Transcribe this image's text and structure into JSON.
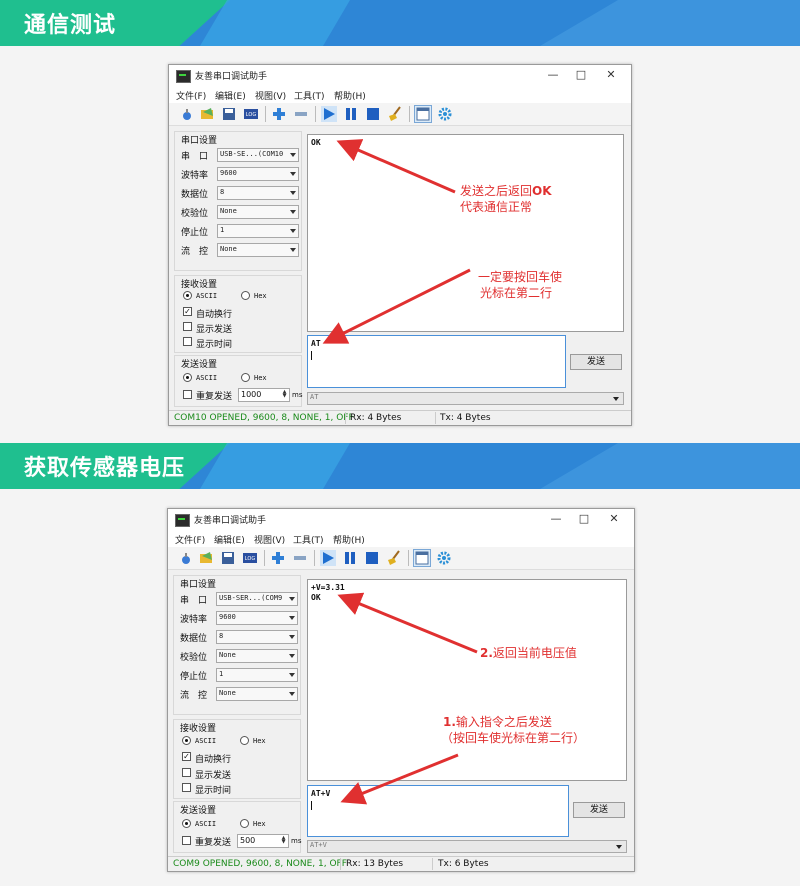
{
  "sections": [
    {
      "banner": "通信测试",
      "window": {
        "title": "友善串口调试助手",
        "menu": [
          "文件(F)",
          "编辑(E)",
          "视图(V)",
          "工具(T)",
          "帮助(H)"
        ],
        "serial": {
          "heading": "串口设置",
          "port_label": "串　口",
          "port": "USB-SE...(COM10",
          "baud_label": "波特率",
          "baud": "9600",
          "data_label": "数据位",
          "data_bits": "8",
          "parity_label": "校验位",
          "parity": "None",
          "stop_label": "停止位",
          "stop_bits": "1",
          "flow_label": "流　控",
          "flow": "None"
        },
        "receive": {
          "heading": "接收设置",
          "ascii": "ASCII",
          "hex": "Hex",
          "auto_newline": "自动换行",
          "show_send": "显示发送",
          "show_time": "显示时间"
        },
        "send": {
          "heading": "发送设置",
          "ascii": "ASCII",
          "hex": "Hex",
          "repeat": "重复发送",
          "interval": "1000",
          "unit": "ms"
        },
        "rx_text": "OK",
        "tx_text": "AT",
        "send_button": "发送",
        "history": "AT",
        "status": {
          "port": "COM10 OPENED, 9600, 8, NONE, 1, OFF",
          "rx": "Rx: 4 Bytes",
          "tx": "Tx: 4 Bytes"
        }
      },
      "annotations": {
        "a1_line1_pre": "发送之后返回",
        "a1_line1_bold": "OK",
        "a1_line2": "代表通信正常",
        "a2_line1": "一定要按回车使",
        "a2_line2": "光标在第二行"
      }
    },
    {
      "banner": "获取传感器电压",
      "window": {
        "title": "友善串口调试助手",
        "menu": [
          "文件(F)",
          "编辑(E)",
          "视图(V)",
          "工具(T)",
          "帮助(H)"
        ],
        "serial": {
          "heading": "串口设置",
          "port_label": "串　口",
          "port": "USB-SER...(COM9",
          "baud_label": "波特率",
          "baud": "9600",
          "data_label": "数据位",
          "data_bits": "8",
          "parity_label": "校验位",
          "parity": "None",
          "stop_label": "停止位",
          "stop_bits": "1",
          "flow_label": "流　控",
          "flow": "None"
        },
        "receive": {
          "heading": "接收设置",
          "ascii": "ASCII",
          "hex": "Hex",
          "auto_newline": "自动换行",
          "show_send": "显示发送",
          "show_time": "显示时间"
        },
        "send": {
          "heading": "发送设置",
          "ascii": "ASCII",
          "hex": "Hex",
          "repeat": "重复发送",
          "interval": "500",
          "unit": "ms"
        },
        "rx_text": "+V=3.31\nOK",
        "tx_text": "AT+V",
        "send_button": "发送",
        "history": "AT+V",
        "status": {
          "port": "COM9 OPENED, 9600, 8, NONE, 1, OFF",
          "rx": "Rx: 13 Bytes",
          "tx": "Tx: 6 Bytes"
        }
      },
      "annotations": {
        "a1_num": "2.",
        "a1_text": "返回当前电压值",
        "a2_num": "1.",
        "a2_text": "输入指令之后发送",
        "a2_line2": "（按回车使光标在第二行）"
      }
    }
  ],
  "colors": {
    "banner_green": "#1fbf8f",
    "banner_blue": "#2e86d6",
    "annotation_red": "#e03030",
    "status_green": "#1a8a1a"
  }
}
